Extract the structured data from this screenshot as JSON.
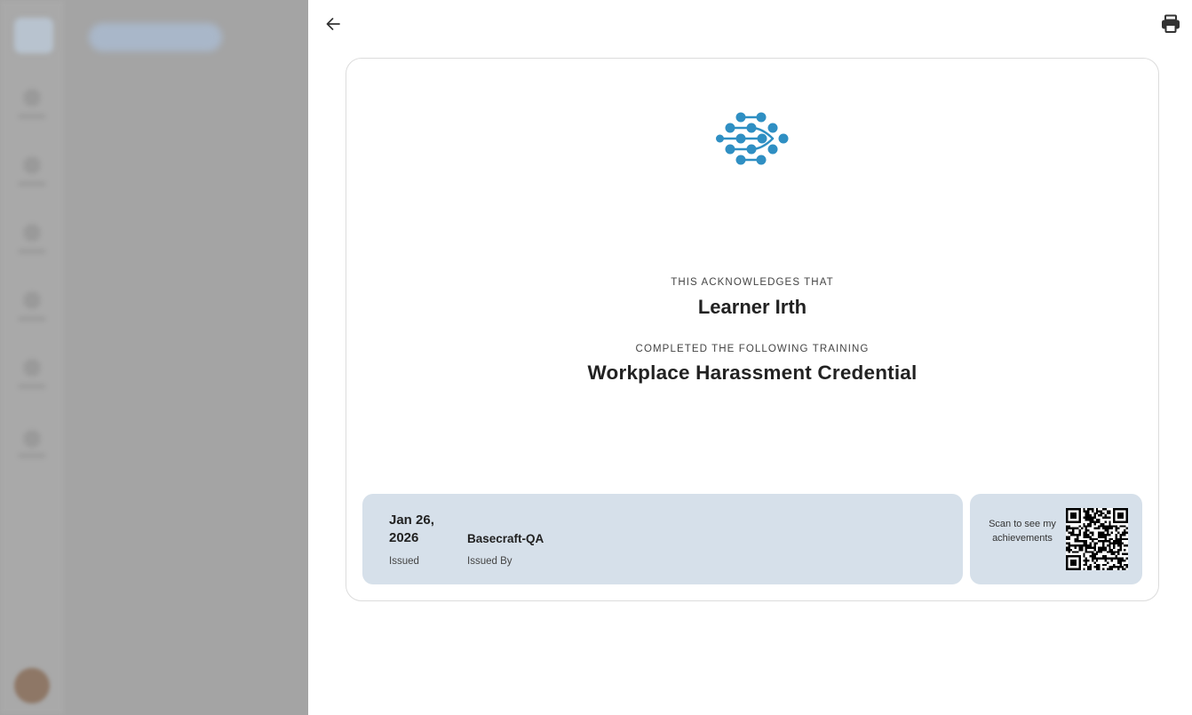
{
  "certificate": {
    "acknowledge_label": "THIS ACKNOWLEDGES THAT",
    "learner_name": "Learner Irth",
    "completed_label": "COMPLETED THE FOLLOWING TRAINING",
    "course_title": "Workplace Harassment Credential",
    "issued_date": "Jan 26, 2026",
    "issued_label": "Issued",
    "issuer_name": "Basecraft-QA",
    "issuer_label": "Issued By",
    "qr_text": "Scan to see my achievements"
  },
  "icons": {
    "back": "arrow-left-icon",
    "print": "printer-icon",
    "logo": "network-dots-logo",
    "qr": "qr-code"
  },
  "colors": {
    "logo": "#2f8fc3",
    "panel": "#d6e0ea",
    "overlay": "#a4a4a4"
  }
}
